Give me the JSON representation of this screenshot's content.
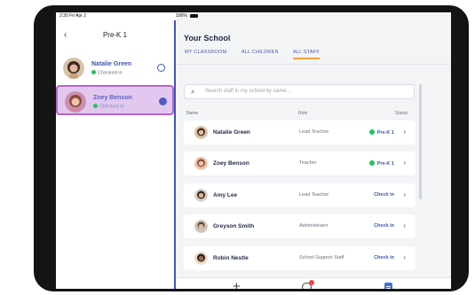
{
  "status_bar": {
    "time": "2:30 Fri Apr 2",
    "battery": "100%"
  },
  "left_pane": {
    "back_icon": "chevron-left-icon",
    "title": "Pre-K 1",
    "children": [
      {
        "name": "Natalie Green",
        "status": "Checked in",
        "selected": false
      },
      {
        "name": "Zoey Benson",
        "status": "Checked in",
        "selected": true
      }
    ]
  },
  "right_pane": {
    "heading": "Your School",
    "tabs": [
      {
        "label": "MY CLASSROOM",
        "active": false
      },
      {
        "label": "ALL CHILDREN",
        "active": false
      },
      {
        "label": "ALL STAFF",
        "active": true
      }
    ],
    "search": {
      "placeholder": "Search staff in my school by name..."
    },
    "columns": {
      "name": "Name",
      "role": "Role",
      "status": "Status"
    },
    "staff": [
      {
        "name": "Natalie Green",
        "role": "Lead Teacher",
        "status": "Pre-K 1",
        "checked_in": true
      },
      {
        "name": "Zoey Benson",
        "role": "Teacher",
        "status": "Pre-K 1",
        "checked_in": true
      },
      {
        "name": "Amy Lee",
        "role": "Lead Teacher",
        "status": "Check in",
        "checked_in": false
      },
      {
        "name": "Greyson Smith",
        "role": "Administrator",
        "status": "Check in",
        "checked_in": false
      },
      {
        "name": "Robin Nestle",
        "role": "School Support Staff",
        "status": "Check in",
        "checked_in": false
      }
    ]
  },
  "bottom_bar": {
    "icons": [
      "plus-icon",
      "chat-icon",
      "clipboard-icon"
    ]
  },
  "colors": {
    "accent": "#3f55b8",
    "tab_underline": "#f2a23a",
    "selected_bg": "#e2c8ee",
    "selected_border": "#b565ce",
    "checked_in": "#22c55e"
  }
}
